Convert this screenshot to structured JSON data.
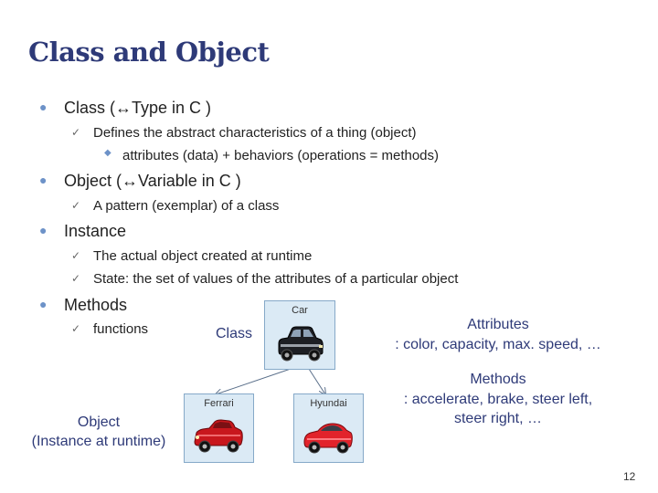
{
  "slide": {
    "title": "Class and Object",
    "page_number": "12"
  },
  "bullets": {
    "class": {
      "label": "Class  (↔Type in C )",
      "sub": "Defines the abstract characteristics of a thing (object)",
      "subsub": "attributes (data) + behaviors (operations = methods)"
    },
    "object": {
      "label": "Object (↔Variable in C )",
      "sub": "A pattern (exemplar) of a class"
    },
    "instance": {
      "label": "Instance",
      "sub1": "The actual object created at runtime",
      "sub2": "State: the set of values of the attributes of a particular object"
    },
    "methods": {
      "label": "Methods",
      "sub": "functions"
    }
  },
  "diagram": {
    "class_box_label": "Car",
    "object_box_1_label": "Ferrari",
    "object_box_2_label": "Hyundai",
    "class_caption": "Class",
    "object_caption_line1": "Object",
    "object_caption_line2": "(Instance at runtime)",
    "attributes_heading": "Attributes",
    "attributes_text": ": color, capacity, max. speed, …",
    "methods_heading": "Methods",
    "methods_text_line1": ": accelerate, brake, steer left,",
    "methods_text_line2": "steer right, …"
  },
  "icons": {
    "level1_bullet": "dot-bullet",
    "level2_bullet": "checkmark-bullet",
    "level3_bullet": "diamond-bullet",
    "class_image": "black-car-icon",
    "object_image_1": "red-convertible-car-icon",
    "object_image_2": "red-sedan-car-icon"
  },
  "colors": {
    "title": "#2e3a78",
    "accent_text": "#2e3a78",
    "bullet": "#6d92c8",
    "box_fill": "#dbeaf5",
    "box_border": "#86a9c8"
  }
}
